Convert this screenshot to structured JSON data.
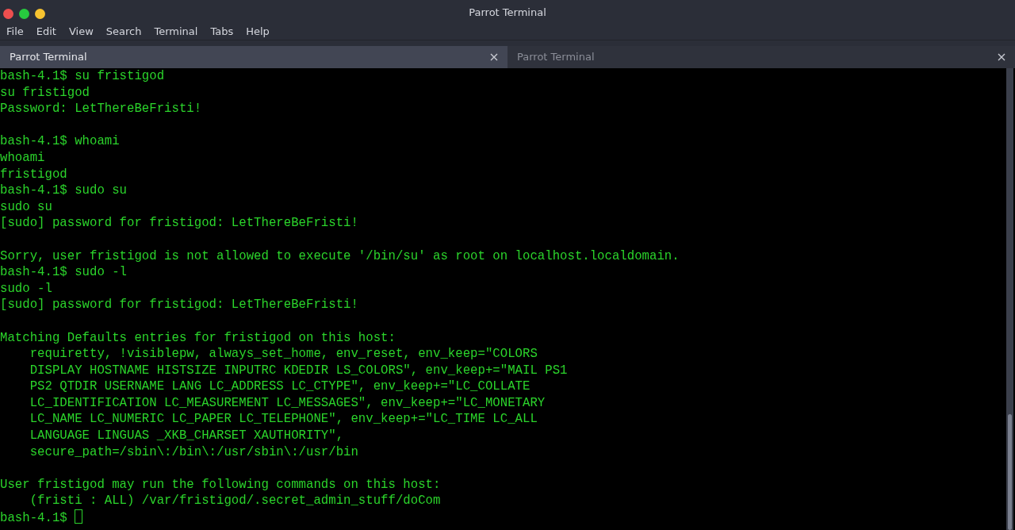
{
  "window": {
    "title": "Parrot Terminal"
  },
  "menu": [
    "File",
    "Edit",
    "View",
    "Search",
    "Terminal",
    "Tabs",
    "Help"
  ],
  "tabs": [
    {
      "label": "Parrot Terminal",
      "selected": true
    },
    {
      "label": "Parrot Terminal",
      "selected": false
    }
  ],
  "terminal": {
    "blocks": [
      [
        "bash-4.1$ su fristigod",
        "su fristigod",
        "Password: LetThereBeFristi!"
      ],
      [
        "bash-4.1$ whoami",
        "whoami",
        "fristigod",
        "bash-4.1$ sudo su",
        "sudo su",
        "[sudo] password for fristigod: LetThereBeFristi!"
      ],
      [
        "Sorry, user fristigod is not allowed to execute '/bin/su' as root on localhost.localdomain.",
        "bash-4.1$ sudo -l",
        "sudo -l",
        "[sudo] password for fristigod: LetThereBeFristi!"
      ],
      [
        "Matching Defaults entries for fristigod on this host:",
        "    requiretty, !visiblepw, always_set_home, env_reset, env_keep=\"COLORS",
        "    DISPLAY HOSTNAME HISTSIZE INPUTRC KDEDIR LS_COLORS\", env_keep+=\"MAIL PS1",
        "    PS2 QTDIR USERNAME LANG LC_ADDRESS LC_CTYPE\", env_keep+=\"LC_COLLATE",
        "    LC_IDENTIFICATION LC_MEASUREMENT LC_MESSAGES\", env_keep+=\"LC_MONETARY",
        "    LC_NAME LC_NUMERIC LC_PAPER LC_TELEPHONE\", env_keep+=\"LC_TIME LC_ALL",
        "    LANGUAGE LINGUAS _XKB_CHARSET XAUTHORITY\",",
        "    secure_path=/sbin\\:/bin\\:/usr/sbin\\:/usr/bin"
      ],
      [
        "User fristigod may run the following commands on this host:",
        "    (fristi : ALL) /var/fristigod/.secret_admin_stuff/doCom"
      ]
    ],
    "prompt": "bash-4.1$"
  }
}
